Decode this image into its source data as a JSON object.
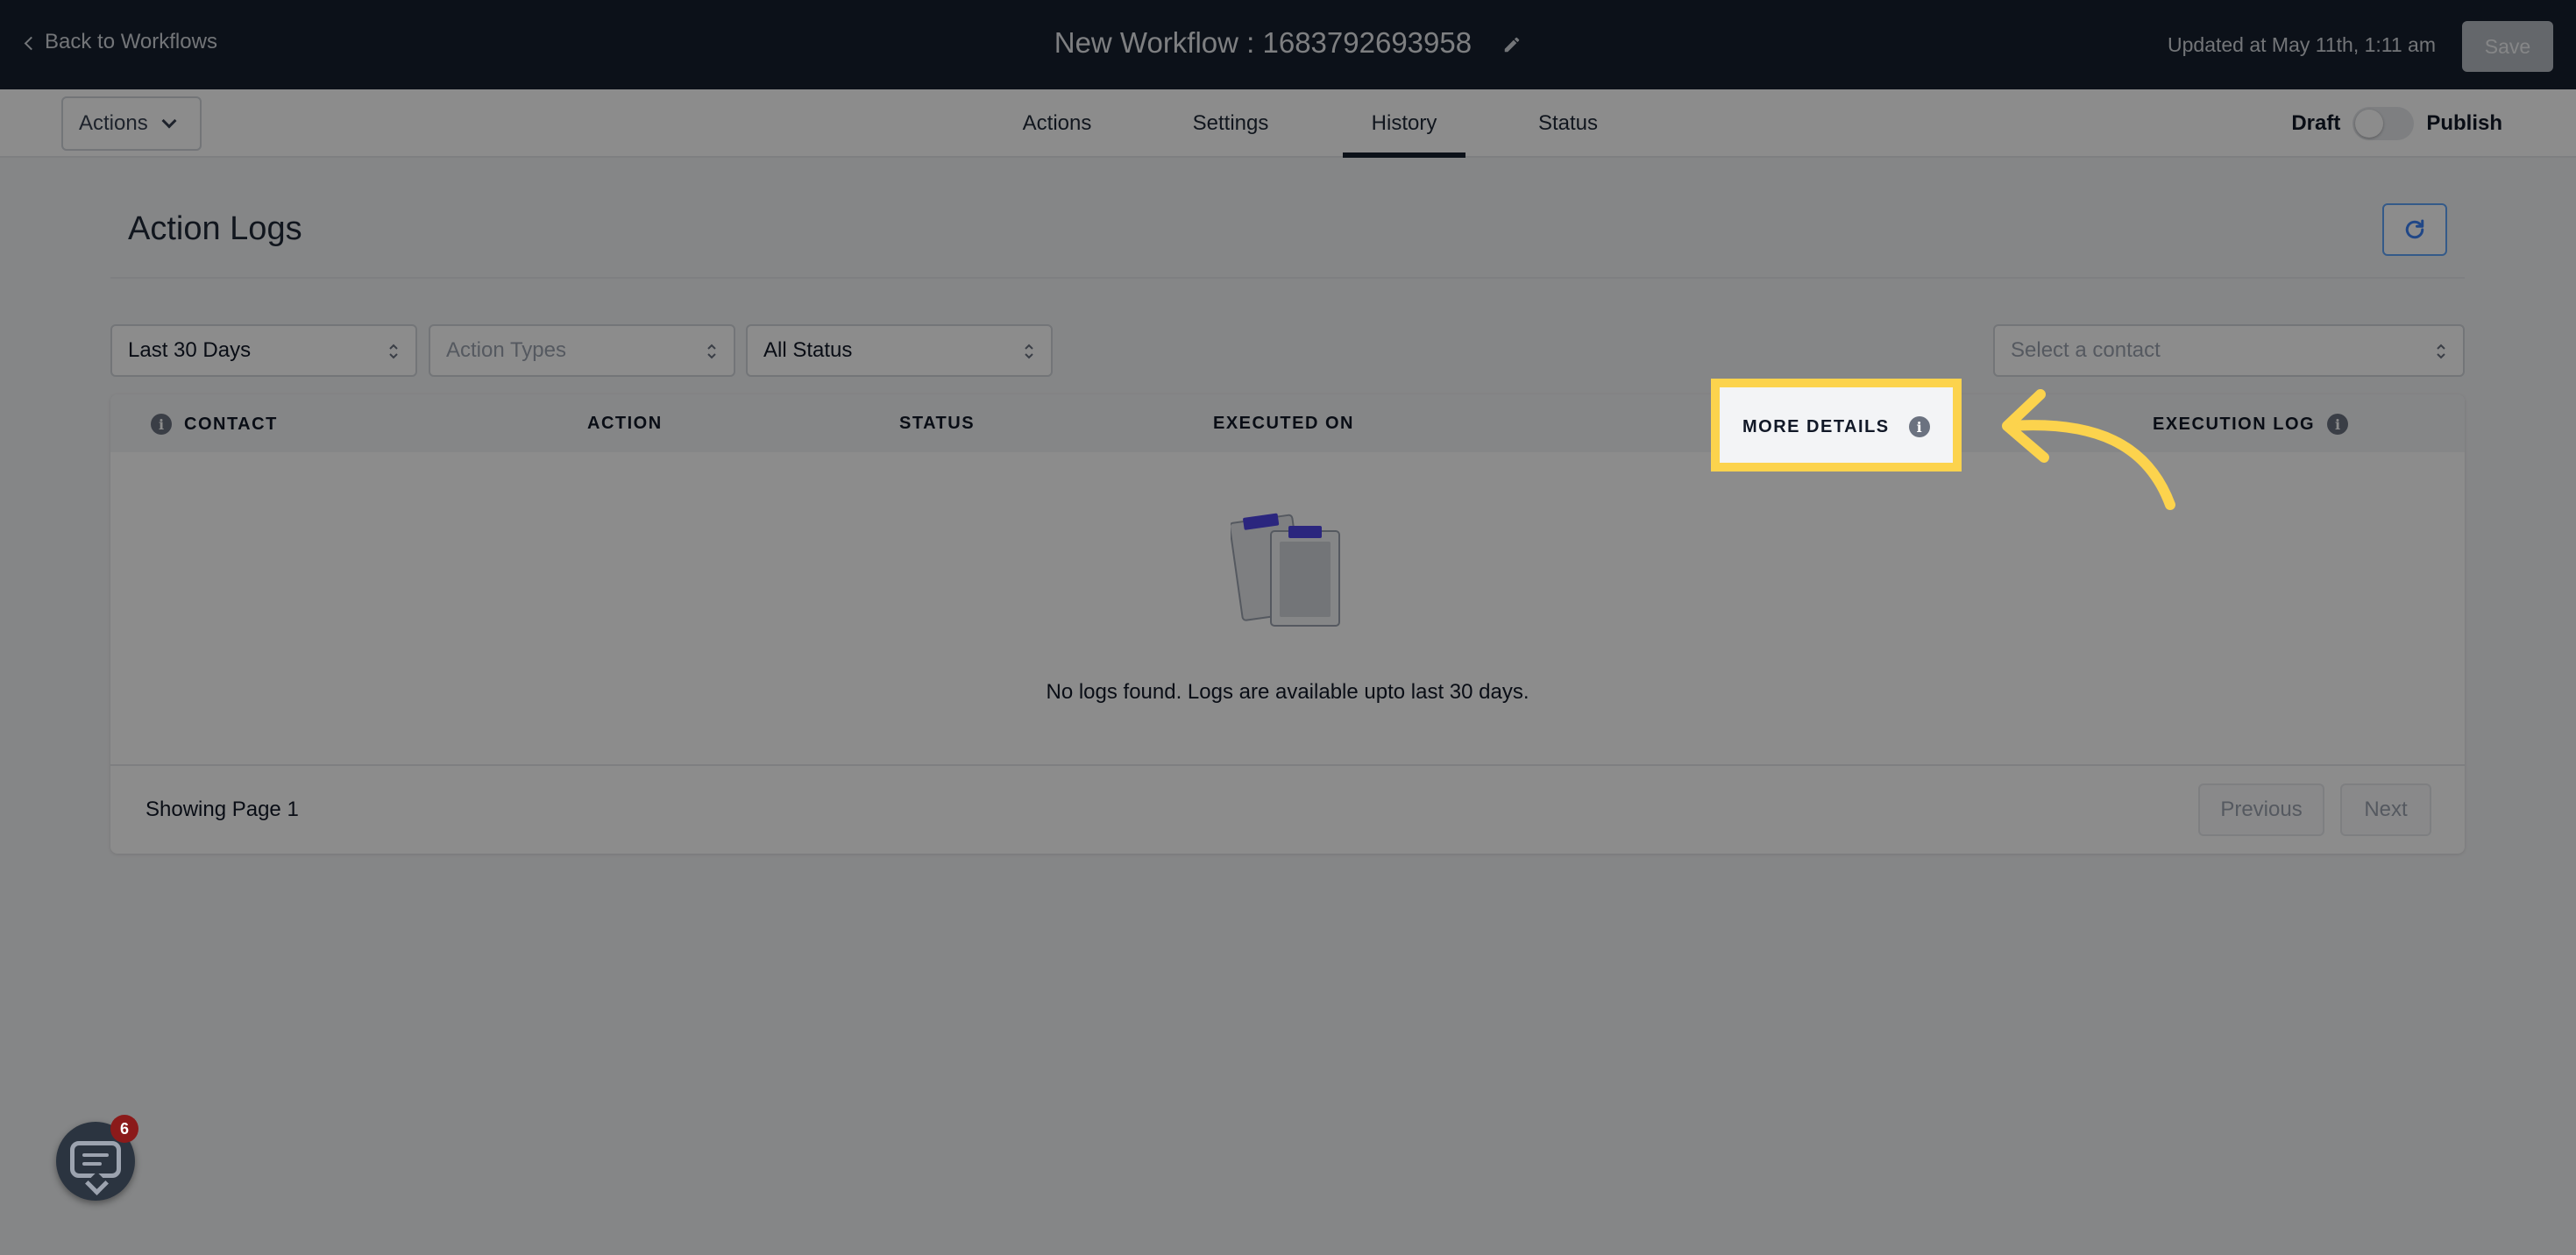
{
  "topbar": {
    "back_label": "Back to Workflows",
    "title": "New Workflow : 1683792693958",
    "updated": "Updated at May 11th, 1:11 am",
    "save_label": "Save"
  },
  "subbar": {
    "actions_dropdown": "Actions",
    "tabs": [
      {
        "label": "Actions",
        "active": false
      },
      {
        "label": "Settings",
        "active": false
      },
      {
        "label": "History",
        "active": true
      },
      {
        "label": "Status",
        "active": false
      }
    ],
    "draft_label": "Draft",
    "publish_label": "Publish"
  },
  "content": {
    "title": "Action Logs",
    "filters": {
      "date": "Last 30 Days",
      "action_types": "Action Types",
      "status": "All Status",
      "contact": "Select a contact"
    },
    "columns": {
      "contact": "CONTACT",
      "action": "ACTION",
      "status": "STATUS",
      "executed_on": "EXECUTED ON",
      "more_details": "MORE DETAILS",
      "execution_log": "EXECUTION LOG"
    },
    "empty_message": "No logs found. Logs are available upto last 30 days.",
    "pagination": {
      "showing": "Showing Page 1",
      "previous": "Previous",
      "next": "Next"
    }
  },
  "chat": {
    "badge": "6"
  },
  "colors": {
    "topbar": "#16202f",
    "highlight": "#fcd34d",
    "accent_blue": "#60a5fa",
    "badge": "#8b1a1a"
  }
}
